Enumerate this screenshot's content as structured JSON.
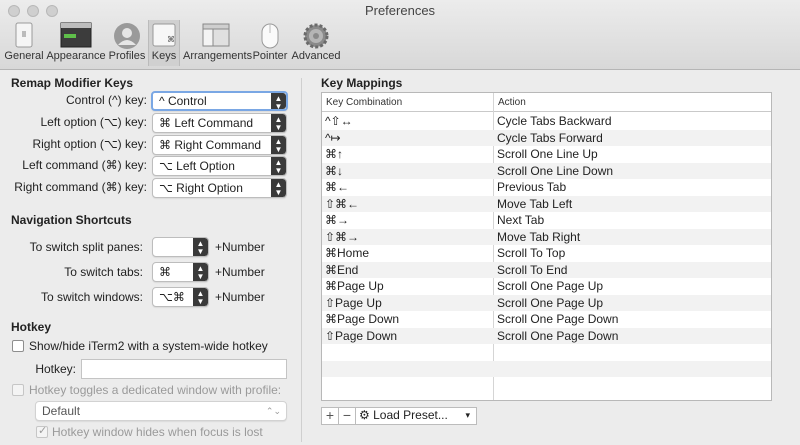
{
  "window": {
    "title": "Preferences"
  },
  "toolbar": {
    "items": [
      {
        "label": "General",
        "icon": "general-icon"
      },
      {
        "label": "Appearance",
        "icon": "appearance-icon"
      },
      {
        "label": "Profiles",
        "icon": "profiles-icon"
      },
      {
        "label": "Keys",
        "icon": "keys-icon",
        "selected": true
      },
      {
        "label": "Arrangements",
        "icon": "arrangements-icon"
      },
      {
        "label": "Pointer",
        "icon": "pointer-icon"
      },
      {
        "label": "Advanced",
        "icon": "gear-icon"
      }
    ]
  },
  "remap": {
    "title": "Remap Modifier Keys",
    "rows": [
      {
        "label": "Control (^) key:",
        "value": "^ Control"
      },
      {
        "label": "Left option (⌥) key:",
        "value": "⌘ Left Command"
      },
      {
        "label": "Right option (⌥) key:",
        "value": "⌘ Right Command"
      },
      {
        "label": "Left command (⌘) key:",
        "value": "⌥ Left Option"
      },
      {
        "label": "Right command (⌘) key:",
        "value": "⌥ Right Option"
      }
    ]
  },
  "nav": {
    "title": "Navigation Shortcuts",
    "rows": [
      {
        "label": "To switch split panes:",
        "value": "",
        "suffix": "+Number"
      },
      {
        "label": "To switch tabs:",
        "value": "⌘",
        "suffix": "+Number"
      },
      {
        "label": "To switch windows:",
        "value": "⌥⌘",
        "suffix": "+Number"
      }
    ]
  },
  "hotkey": {
    "title": "Hotkey",
    "show_hide_label": "Show/hide iTerm2 with a system-wide hotkey",
    "hotkey_label": "Hotkey:",
    "hotkey_value": "",
    "dedicated_label": "Hotkey toggles a dedicated window with profile:",
    "profile_value": "Default",
    "hides_label": "Hotkey window hides when focus is lost"
  },
  "mappings": {
    "title": "Key Mappings",
    "columns": [
      "Key Combination",
      "Action"
    ],
    "rows": [
      {
        "key": "^⇧↔",
        "action": "Cycle Tabs Backward"
      },
      {
        "key": "^↦",
        "action": "Cycle Tabs Forward"
      },
      {
        "key": "⌘↑",
        "action": "Scroll One Line Up"
      },
      {
        "key": "⌘↓",
        "action": "Scroll One Line Down"
      },
      {
        "key": "⌘←",
        "action": "Previous Tab"
      },
      {
        "key": "⇧⌘←",
        "action": "Move Tab Left"
      },
      {
        "key": "⌘→",
        "action": "Next Tab"
      },
      {
        "key": "⇧⌘→",
        "action": "Move Tab Right"
      },
      {
        "key": "⌘Home",
        "action": "Scroll To Top"
      },
      {
        "key": "⌘End",
        "action": "Scroll To End"
      },
      {
        "key": "⌘Page Up",
        "action": "Scroll One Page Up"
      },
      {
        "key": "⇧Page Up",
        "action": "Scroll One Page Up"
      },
      {
        "key": "⌘Page Down",
        "action": "Scroll One Page Down"
      },
      {
        "key": "⇧Page Down",
        "action": "Scroll One Page Down"
      }
    ],
    "add_label": "+",
    "remove_label": "−",
    "load_preset_label": "Load Preset..."
  },
  "colors": {
    "focus_ring": "#7aa7e4",
    "stepper": "#3a3a3a",
    "alt_row": "#f2f2f2"
  }
}
